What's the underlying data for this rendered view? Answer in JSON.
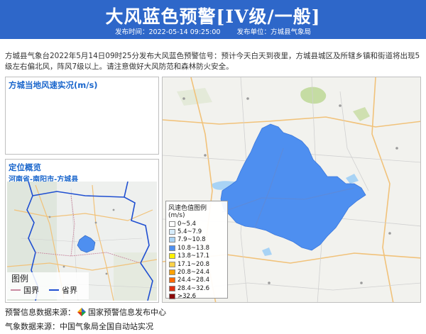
{
  "header": {
    "title": "大风蓝色预警[IV级/一般]",
    "publish_time": "发布时间：2022-05-14 09:25:00",
    "publish_unit": "发布单位：方城县气象局"
  },
  "description": "方城县气象台2022年5月14日09时25分发布大风蓝色预警信号：预计今天白天到夜里，方城县城区及所辖乡镇和街道将出现5级左右偏北风，阵风7级以上。请注意做好大风防范和森林防火安全。",
  "wind_panel": {
    "title": "方城当地风速实况(m/s)"
  },
  "location_panel": {
    "title": "定位概览",
    "region": "河南省-南阳市-方城县",
    "legend": {
      "title": "图例",
      "items": [
        {
          "label": "国界",
          "color": "#c98aa0"
        },
        {
          "label": "省界",
          "color": "#1f4fd1"
        }
      ]
    }
  },
  "map_legend": {
    "title": "风速色值图例 (m/s)",
    "items": [
      {
        "label": "0~5.4",
        "color": "#ffffff"
      },
      {
        "label": "5.4~7.9",
        "color": "#d6ecfb"
      },
      {
        "label": "7.9~10.8",
        "color": "#a8d3f5"
      },
      {
        "label": "10.8~13.8",
        "color": "#4e8ff0"
      },
      {
        "label": "13.8~17.1",
        "color": "#fff200"
      },
      {
        "label": "17.1~20.8",
        "color": "#ffd24a"
      },
      {
        "label": "20.8~24.4",
        "color": "#ffa200"
      },
      {
        "label": "24.4~28.4",
        "color": "#ff6a00"
      },
      {
        "label": "28.4~32.6",
        "color": "#e0300f"
      },
      {
        "label": ">32.6",
        "color": "#8b0a0a"
      }
    ]
  },
  "warning_area_color": "#4e8ff0",
  "footer": {
    "warning_source": "预警信息数据来源：",
    "warning_source_name": "国家预警信息发布中心",
    "weather_source": "气象数据来源：中国气象局全国自动站实况"
  }
}
